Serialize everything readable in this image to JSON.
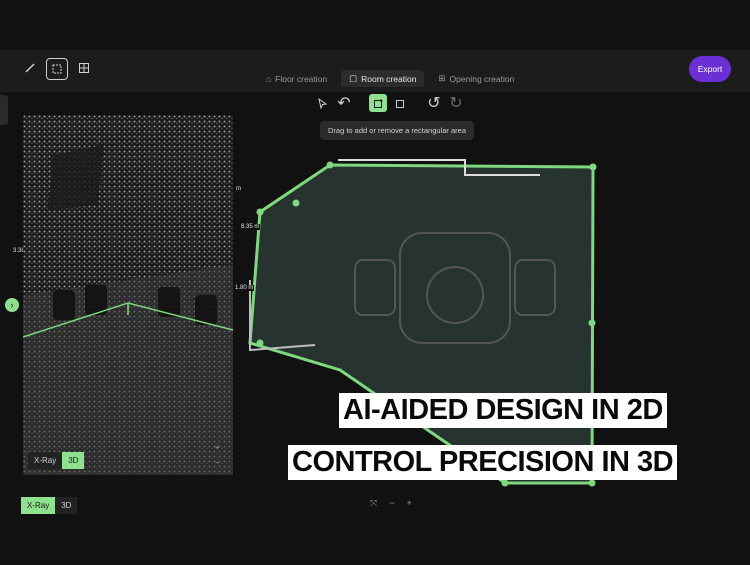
{
  "toolbar": {
    "tabs": [
      {
        "label": "Floor creation",
        "icon": "house-icon"
      },
      {
        "label": "Room creation",
        "icon": "room-icon"
      },
      {
        "label": "Opening creation",
        "icon": "window-icon"
      }
    ],
    "export_label": "Export"
  },
  "edit_tools": {
    "tooltip": "Drag to add or remove a rectangular area"
  },
  "view_toggle_inner": {
    "options": [
      "X-Ray",
      "3D"
    ],
    "selected": "3D"
  },
  "view_toggle_outer": {
    "options": [
      "X-Ray",
      "3D"
    ],
    "selected": "X-Ray"
  },
  "measurements": [
    "8.35 m",
    "1.80 m",
    "3.38",
    "m"
  ],
  "pane_zoom": {
    "plus": "+",
    "minus": "−"
  },
  "bottom_controls": {
    "fit": "⤧",
    "minus": "−",
    "plus": "+"
  },
  "expand": {
    "label": "›"
  },
  "banners": {
    "line1": "AI-AIDED DESIGN IN 2D",
    "line2": "CONTROL PRECISION IN 3D"
  },
  "colors": {
    "accent_green": "#8fe08f",
    "room_outline": "#7fd87f",
    "export_purple": "#6b2fd6"
  }
}
